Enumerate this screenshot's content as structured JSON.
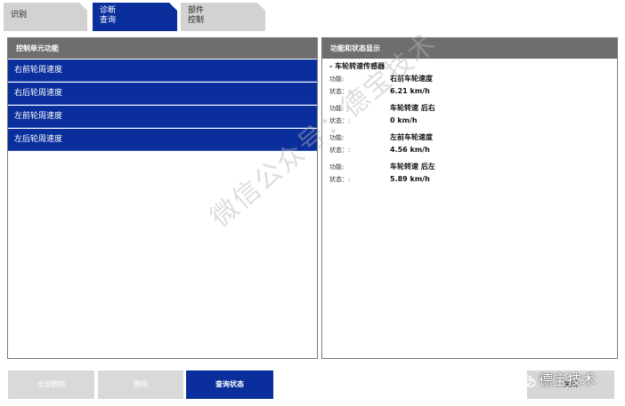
{
  "tabs": [
    {
      "line1": "识别",
      "line2": ""
    },
    {
      "line1": "诊断",
      "line2": "查询"
    },
    {
      "line1": "部件",
      "line2": "控制"
    }
  ],
  "left_panel": {
    "title": "控制单元功能",
    "items": [
      "右前轮周速度",
      "右后轮周速度",
      "左前轮周速度",
      "左后轮周速度"
    ]
  },
  "right_panel": {
    "title": "功能和状态显示",
    "group": "- 车轮转速传感器",
    "entries": [
      {
        "function_label": "功能:",
        "function_value": "右前车轮速度",
        "status_label": "状态：:",
        "status_value": "6.21  km/h"
      },
      {
        "function_label": "功能:",
        "function_value": "车轮转速 后右",
        "status_label": "状态：:",
        "status_value": "0  km/h"
      },
      {
        "function_label": "功能:",
        "function_value": "左前车轮速度",
        "status_label": "状态：:",
        "status_value": "4.56  km/h"
      },
      {
        "function_label": "功能:",
        "function_value": "车轮转速 后左",
        "status_label": "状态：:",
        "status_value": "5.89  km/h"
      }
    ]
  },
  "buttons": {
    "clear_all": "全部删除",
    "clear": "删除",
    "query_status": "查询状态",
    "close": "关闭"
  },
  "watermark": "微信公众号：德宝技术",
  "brand": "德宝技术",
  "colors": {
    "accent": "#0a2f9c",
    "header_gray": "#6e6e6e",
    "tab_gray": "#d2d2d2"
  }
}
